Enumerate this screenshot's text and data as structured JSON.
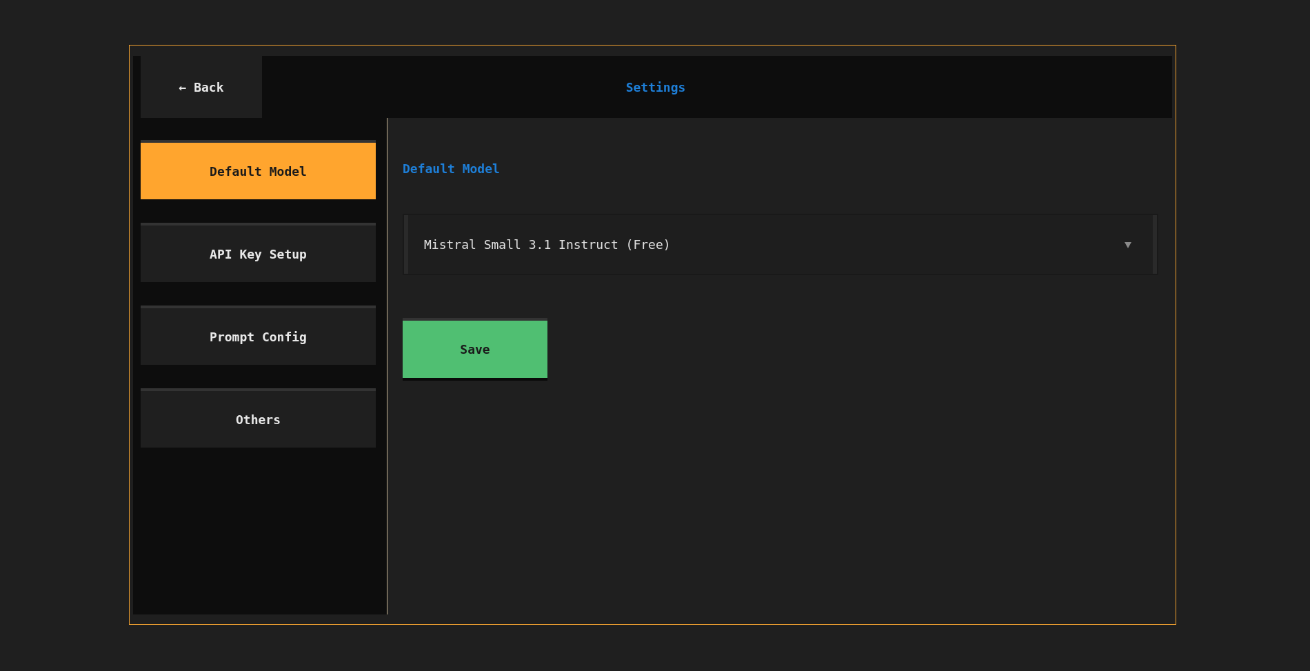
{
  "header": {
    "back_button": "← Back",
    "title": "Settings"
  },
  "sidebar": {
    "items": [
      {
        "label": "Default Model",
        "selected": true
      },
      {
        "label": "API Key Setup",
        "selected": false
      },
      {
        "label": "Prompt Config",
        "selected": false
      },
      {
        "label": "Others",
        "selected": false
      }
    ]
  },
  "content": {
    "heading": "Default Model",
    "model_select": {
      "value": "Mistral Small 3.1 Instruct (Free)"
    },
    "save_button": "Save"
  }
}
